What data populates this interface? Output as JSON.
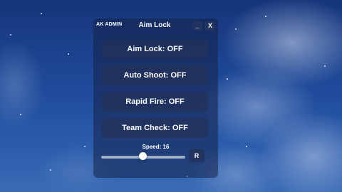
{
  "window": {
    "brand": "AK ADMIN",
    "title": "Aim Lock",
    "minimize_label": "_",
    "close_label": "X"
  },
  "toggles": [
    {
      "label": "Aim Lock: OFF"
    },
    {
      "label": "Auto Shoot: OFF"
    },
    {
      "label": "Rapid Fire: OFF"
    },
    {
      "label": "Team Check: OFF"
    }
  ],
  "speed": {
    "label": "Speed: 16",
    "value": 16,
    "slider_fraction": 0.5
  },
  "reset": {
    "label": "R"
  },
  "colors": {
    "panel": "#14234b",
    "button": "#23325a",
    "text": "#ffffff",
    "sky": "#1f4a99"
  }
}
